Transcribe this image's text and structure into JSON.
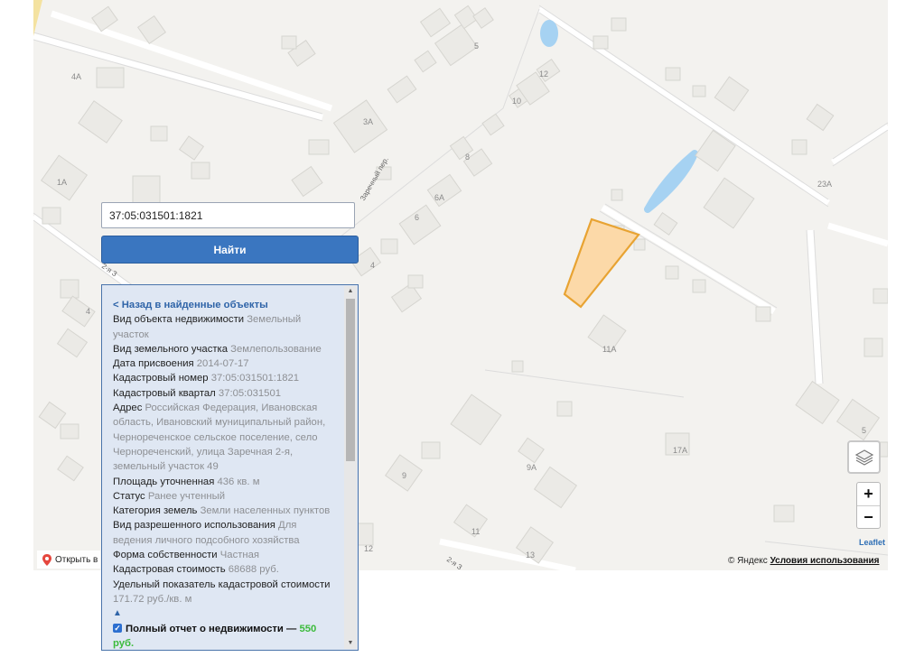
{
  "search": {
    "value": "37:05:031501:1821"
  },
  "find_button": "Найти",
  "panel": {
    "back": "< Назад в найденные объекты",
    "fields": [
      {
        "label": "Вид объекта недвижимости",
        "value": "Земельный участок"
      },
      {
        "label": "Вид земельного участка",
        "value": "Землепользование"
      },
      {
        "label": "Дата присвоения",
        "value": "2014-07-17"
      },
      {
        "label": "Кадастровый номер",
        "value": "37:05:031501:1821"
      },
      {
        "label": "Кадастровый квартал",
        "value": "37:05:031501"
      },
      {
        "label": "Адрес",
        "value": "Российская Федерация, Ивановская область, Ивановский муниципальный район, Черноречен­ское сельское поселение, село Черноречен­ский, улица Заречная 2-я, земельный участок 49"
      },
      {
        "label": "Площадь уточненная",
        "value": "436 кв. м"
      },
      {
        "label": "Статус",
        "value": "Ранее учтенный"
      },
      {
        "label": "Категория земель",
        "value": "Земли населенных пунктов"
      },
      {
        "label": "Вид разрешенного использования",
        "value": "Для ведения личного подсобного хозяйства"
      },
      {
        "label": "Форма собственности",
        "value": "Частная"
      },
      {
        "label": "Кадастровая стоимость",
        "value": "68688 руб."
      },
      {
        "label": "Удельный показатель кадастровой стоимости",
        "value": "171.72 руб./кв. м"
      }
    ],
    "collapse": "▲",
    "report_text": "Полный отчет о недвижимости —",
    "report_price": "550 руб."
  },
  "map": {
    "labels": [
      "5",
      "4А",
      "12",
      "10",
      "3А",
      "8",
      "1А",
      "6А",
      "6",
      "23А",
      "4",
      "4",
      "11А",
      "5",
      "17А",
      "9",
      "9А",
      "11",
      "12",
      "13"
    ],
    "street_labels": [
      "Заречный пер.",
      "2-я З",
      "2-я З"
    ],
    "colors": {
      "parcel_fill": "#fcd9a8",
      "parcel_stroke": "#e8a332",
      "water": "#a6d2f2"
    }
  },
  "controls": {
    "zoom_in": "+",
    "zoom_out": "−",
    "leaflet": "Leaflet",
    "attribution_prefix": "© Яндекс",
    "attribution_link": "Условия использования",
    "open_in": "Открыть в"
  }
}
